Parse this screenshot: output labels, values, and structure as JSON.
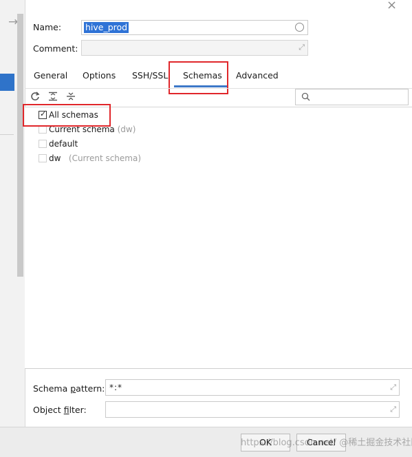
{
  "window": {
    "close_icon": "close-icon",
    "back_icon": "arrow-right-icon"
  },
  "connection": {
    "name_label": "Name:",
    "name_value": "hive_prod",
    "comment_label": "Comment:",
    "comment_value": ""
  },
  "tabs": [
    {
      "label": "General"
    },
    {
      "label": "Options"
    },
    {
      "label": "SSH/SSL"
    },
    {
      "label": "Schemas",
      "active": true
    },
    {
      "label": "Advanced"
    }
  ],
  "toolbar": {
    "refresh_icon": "refresh-icon",
    "expand_icon": "expand-all-icon",
    "collapse_icon": "collapse-all-icon",
    "search_placeholder": ""
  },
  "schemas": [
    {
      "label": "All schemas",
      "hint": "",
      "checked": true
    },
    {
      "label": "Current schema",
      "hint": "(dw)",
      "checked": false
    },
    {
      "label": "default",
      "hint": "",
      "checked": false
    },
    {
      "label": "dw",
      "hint": "(Current schema)",
      "checked": false
    }
  ],
  "filters": {
    "pattern_label_pre": "Schema ",
    "pattern_label_u": "p",
    "pattern_label_post": "attern:",
    "pattern_value": "*:*",
    "filter_label_pre": "Object ",
    "filter_label_u": "f",
    "filter_label_post": "ilter:",
    "filter_value": ""
  },
  "footer": {
    "ok_label": "OK",
    "cancel_label": "Cancel",
    "watermark": "https://blog.csdn.net/  @稀土掘金技术社区"
  },
  "colors": {
    "accent": "#2f73d6",
    "highlight_box": "#e0262a"
  }
}
